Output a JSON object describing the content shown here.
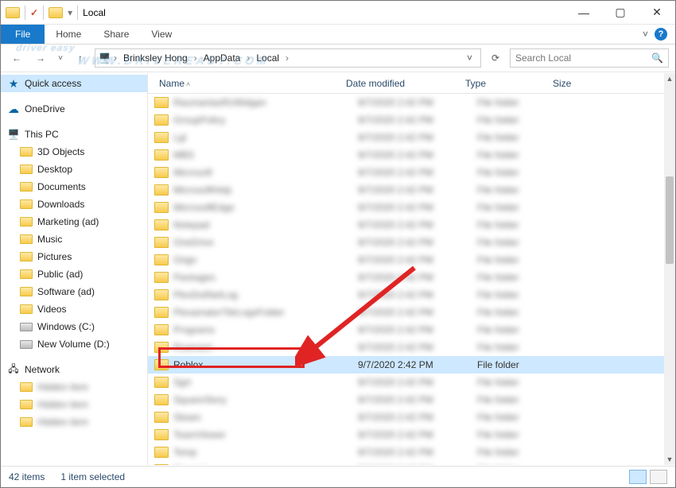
{
  "window": {
    "title": "Local",
    "min": "—",
    "max": "▢",
    "close": "✕",
    "expand": "˅"
  },
  "menu": {
    "file": "File",
    "tabs": [
      "Home",
      "Share",
      "View"
    ]
  },
  "nav": {
    "back": "←",
    "fwd": "→",
    "hist": "˅",
    "up": "↑",
    "refresh": "⟳",
    "dropdown": "˅"
  },
  "breadcrumb": [
    "Brinksley Hong",
    "AppData",
    "Local"
  ],
  "search": {
    "placeholder": "Search Local",
    "icon": "🔍"
  },
  "sidebar": {
    "quick_access": "Quick access",
    "onedrive": "OneDrive",
    "this_pc": "This PC",
    "items": [
      "3D Objects",
      "Desktop",
      "Documents",
      "Downloads",
      "Marketing (ad)",
      "Music",
      "Pictures",
      "Public (ad)",
      "Software (ad)",
      "Videos",
      "Windows (C:)",
      "New Volume (D:)"
    ],
    "network": "Network"
  },
  "columns": {
    "name": "Name",
    "date": "Date modified",
    "type": "Type",
    "size": "Size",
    "sort": "˄"
  },
  "selected_row": {
    "name": "Roblox",
    "date": "9/7/2020 2:42 PM",
    "type": "File folder"
  },
  "blurred": {
    "names": [
      "RaumantasRcWidgan",
      "GroupPolicy",
      "Lgl",
      "MBS",
      "Microsoft",
      "MicrosoftHelp",
      "MicrosoftEdge",
      "Notepad",
      "OneDrive",
      "Orign",
      "Packages",
      "PlexDotNetLog",
      "PlexamatorTileLogsFolder",
      "Programs",
      "Roamant"
    ],
    "names_after": [
      "Sgrt",
      "SquareStory",
      "Steam",
      "TeamViewer",
      "Temp",
      "Tencent"
    ],
    "date": "9/7/2020 2:42 PM",
    "type": "File folder"
  },
  "status": {
    "count": "42 items",
    "selected": "1 item selected"
  },
  "watermark": {
    "line1": "driver easy",
    "line2": "WWW.DRIVEREASY.COM"
  },
  "checkmark": "✓"
}
